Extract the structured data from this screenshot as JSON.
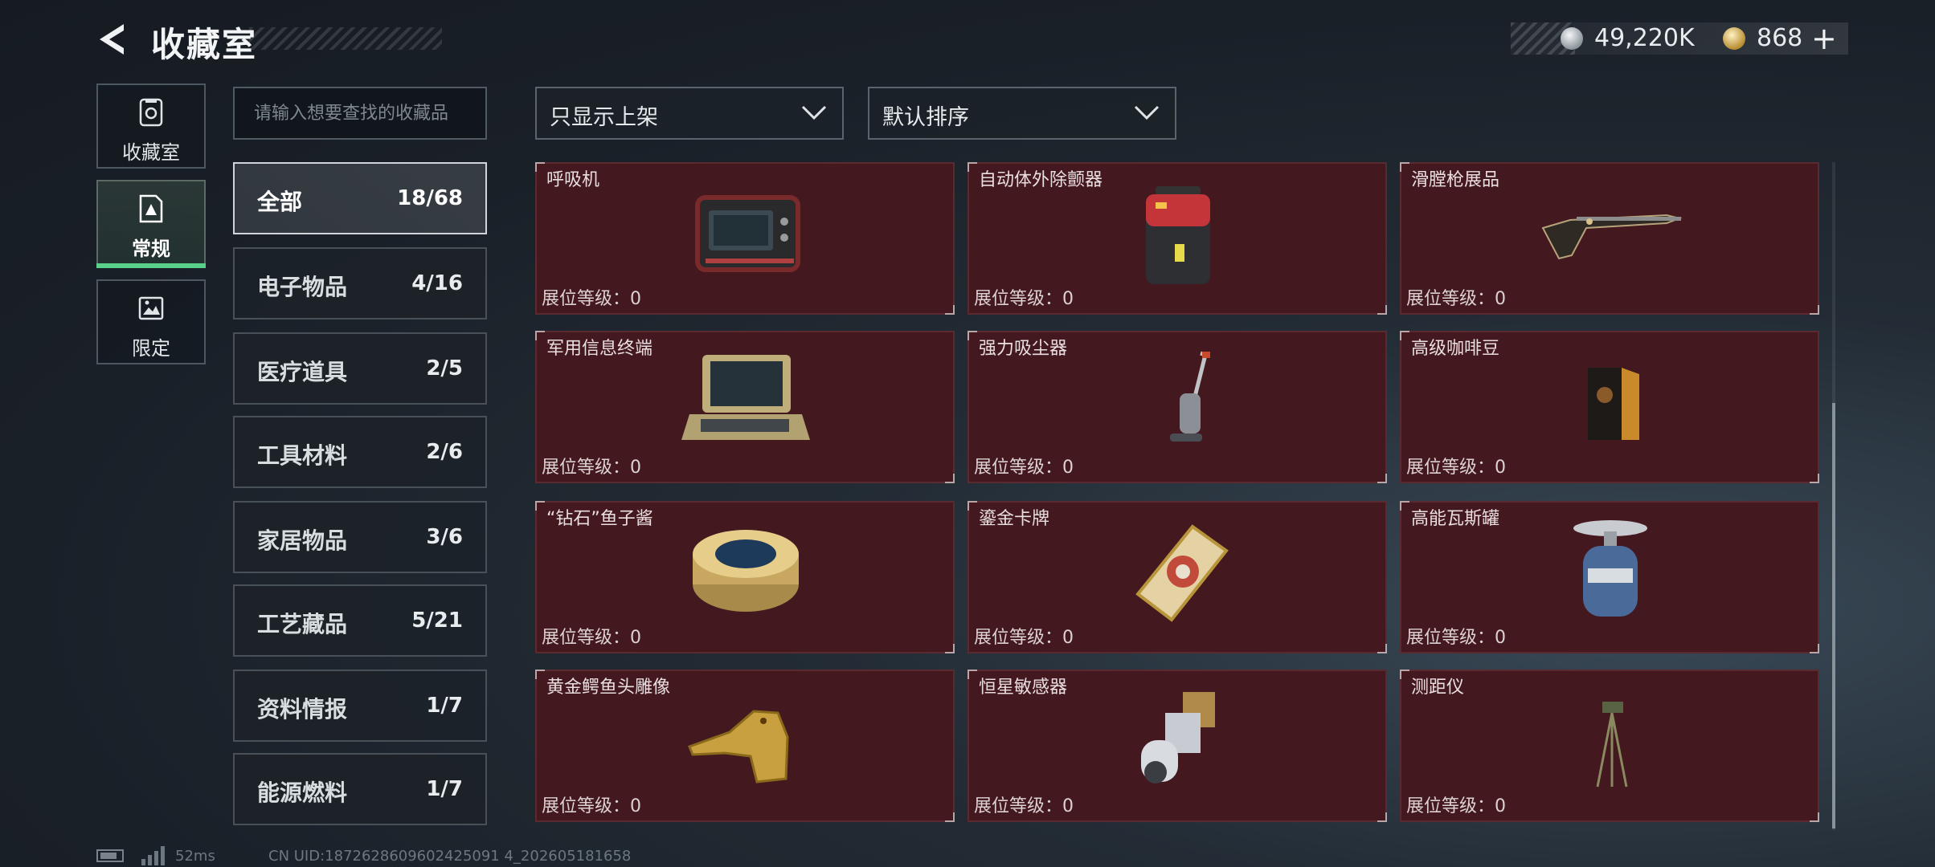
{
  "header": {
    "title": "收藏室",
    "currency_silver": "49,220K",
    "currency_gold": "868",
    "plus_label": "+"
  },
  "side_nav": [
    {
      "label": "收藏室",
      "icon": "collection-icon"
    },
    {
      "label": "常规",
      "icon": "regular-icon"
    },
    {
      "label": "限定",
      "icon": "limited-icon"
    }
  ],
  "search": {
    "placeholder": "请输入想要查找的收藏品"
  },
  "filters": {
    "display_filter": "只显示上架",
    "sort": "默认排序"
  },
  "categories": [
    {
      "name": "全部",
      "count": "18/68"
    },
    {
      "name": "电子物品",
      "count": "4/16"
    },
    {
      "name": "医疗道具",
      "count": "2/5"
    },
    {
      "name": "工具材料",
      "count": "2/6"
    },
    {
      "name": "家居物品",
      "count": "3/6"
    },
    {
      "name": "工艺藏品",
      "count": "5/21"
    },
    {
      "name": "资料情报",
      "count": "1/7"
    },
    {
      "name": "能源燃料",
      "count": "1/7"
    }
  ],
  "level_label": "展位等级：",
  "items": [
    {
      "name": "呼吸机",
      "level": "0",
      "icon": "ventilator-icon"
    },
    {
      "name": "自动体外除颤器",
      "level": "0",
      "icon": "defibrillator-icon"
    },
    {
      "name": "滑膛枪展品",
      "level": "0",
      "icon": "musket-icon"
    },
    {
      "name": "军用信息终端",
      "level": "0",
      "icon": "military-terminal-icon"
    },
    {
      "name": "强力吸尘器",
      "level": "0",
      "icon": "vacuum-icon"
    },
    {
      "name": "高级咖啡豆",
      "level": "0",
      "icon": "coffee-bag-icon"
    },
    {
      "name": "“钻石”鱼子酱",
      "level": "0",
      "icon": "caviar-tin-icon"
    },
    {
      "name": "鎏金卡牌",
      "level": "0",
      "icon": "gilded-card-icon"
    },
    {
      "name": "高能瓦斯罐",
      "level": "0",
      "icon": "gas-canister-icon"
    },
    {
      "name": "黄金鳄鱼头雕像",
      "level": "0",
      "icon": "crocodile-statue-icon"
    },
    {
      "name": "恒星敏感器",
      "level": "0",
      "icon": "star-sensor-icon"
    },
    {
      "name": "测距仪",
      "level": "0",
      "icon": "rangefinder-icon"
    }
  ],
  "status_bar": {
    "ping": "52ms",
    "uid": "CN UID:1872628609602425091 4_202605181658"
  },
  "colors": {
    "card_bg": "#43181f",
    "accent_green": "#59d18b",
    "background": "#1a2028"
  }
}
